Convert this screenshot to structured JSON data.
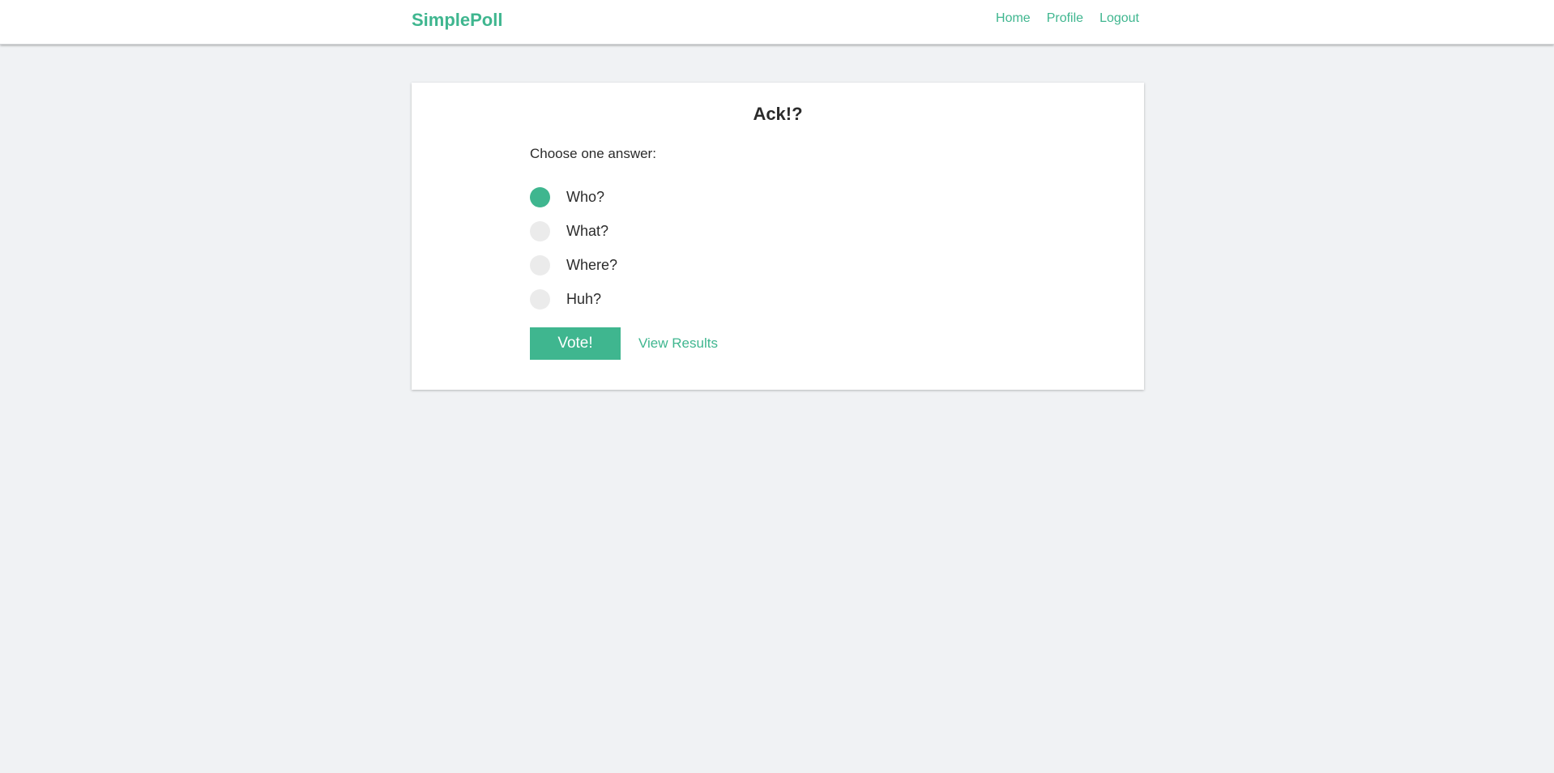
{
  "colors": {
    "accent": "#3fb68f",
    "background": "#f0f2f4",
    "card": "#ffffff",
    "radio_unchecked": "#ebebeb",
    "text": "#2b2b2b"
  },
  "navbar": {
    "brand": "SimplePoll",
    "links": [
      {
        "label": "Home"
      },
      {
        "label": "Profile"
      },
      {
        "label": "Logout"
      }
    ]
  },
  "poll": {
    "title": "Ack!?",
    "instruction": "Choose one answer:",
    "options": [
      {
        "label": "Who?",
        "selected": true
      },
      {
        "label": "What?",
        "selected": false
      },
      {
        "label": "Where?",
        "selected": false
      },
      {
        "label": "Huh?",
        "selected": false
      }
    ],
    "vote_label": "Vote!",
    "results_label": "View Results"
  }
}
